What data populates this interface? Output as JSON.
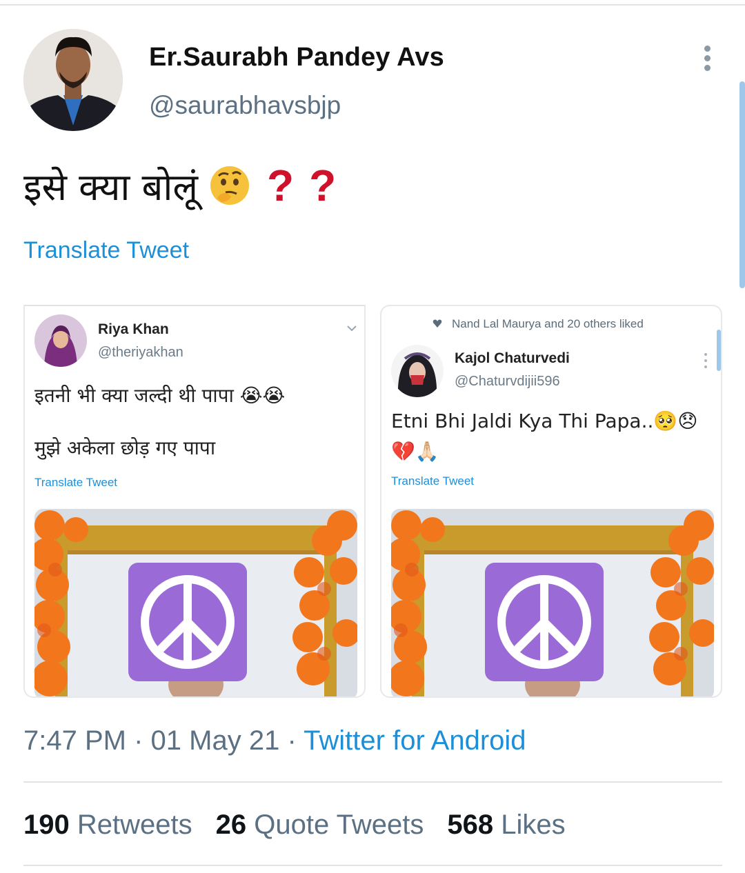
{
  "author": {
    "name": "Er.Saurabh Pandey Avs",
    "handle": "@saurabhavsbjp"
  },
  "tweet": {
    "text": "इसे क्या बोलूं",
    "emoji": "thinking-face",
    "punctuation": [
      "?",
      "?"
    ],
    "translate_label": "Translate Tweet"
  },
  "embedded_left": {
    "name": "Riya Khan",
    "handle": "@theriyakhan",
    "line1": "इतनी भी क्या जल्दी थी पापा 😭😭",
    "line2": "मुझे अकेला छोड़ गए पापा",
    "translate_label": "Translate Tweet"
  },
  "embedded_right": {
    "liked_by": "Nand Lal Maurya and 20 others liked",
    "name": "Kajol Chaturvedi",
    "handle": "@Chaturvdijii596",
    "line1": "Etni Bhi Jaldi Kya Thi Papa..🥺😞",
    "line2": "💔🙏🏻",
    "translate_label": "Translate Tweet"
  },
  "meta": {
    "time": "7:47 PM",
    "separator": "·",
    "date": "01 May 21",
    "source": "Twitter for Android"
  },
  "stats": {
    "retweets_count": "190",
    "retweets_label": "Retweets",
    "quotes_count": "26",
    "quotes_label": "Quote Tweets",
    "likes_count": "568",
    "likes_label": "Likes"
  },
  "colors": {
    "link": "#1d8fd8",
    "secondary_text": "#5b7083",
    "question_mark": "#d0112b",
    "peace_symbol_bg": "#9a6bd6"
  }
}
